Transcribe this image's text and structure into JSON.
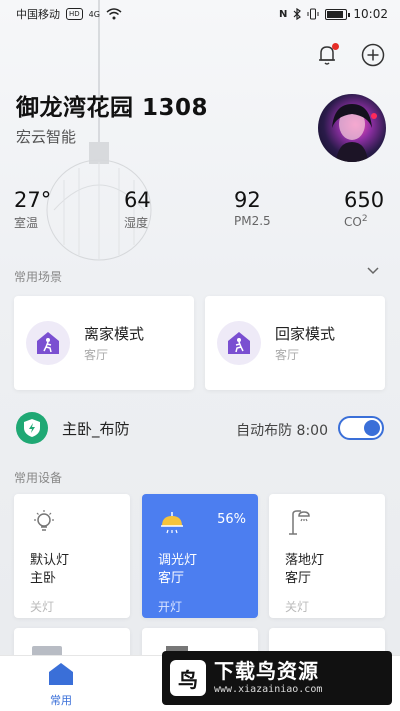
{
  "status_bar": {
    "carrier": "中国移动",
    "hd_badge": "HD",
    "network": "4G",
    "time": "10:02"
  },
  "home": {
    "title": "御龙湾花园 1308",
    "subtitle": "宏云智能"
  },
  "stats": [
    {
      "value": "27°",
      "label": "室温"
    },
    {
      "value": "64",
      "label": "湿度"
    },
    {
      "value": "92",
      "label": "PM2.5"
    },
    {
      "value": "650",
      "label": "CO",
      "label_sup": "2"
    }
  ],
  "scenes_section": {
    "label": "常用场景"
  },
  "scenes": [
    {
      "name": "离家模式",
      "room": "客厅"
    },
    {
      "name": "回家模式",
      "room": "客厅"
    }
  ],
  "security": {
    "name": "主卧_布防",
    "auto_text": "自动布防 8:00",
    "enabled": true
  },
  "devices_section": {
    "label": "常用设备"
  },
  "devices": [
    {
      "name": "默认灯",
      "room": "主卧",
      "state": "关灯",
      "icon": "bulb-icon"
    },
    {
      "name": "调光灯",
      "room": "客厅",
      "state": "开灯",
      "icon": "dimmer-lamp-icon",
      "level": "56%"
    },
    {
      "name": "落地灯",
      "room": "客厅",
      "state": "关灯",
      "icon": "floor-lamp-icon"
    }
  ],
  "bottom_nav": {
    "home_label": "常用"
  },
  "watermark": {
    "title": "下载鸟资源",
    "url": "www.xiazainiao.com"
  },
  "colors": {
    "accent": "#3a6fd8",
    "active_card": "#4c7ef0",
    "scene_icon": "#7a4fd1",
    "shield": "#1fa874",
    "notify_dot": "#e52d27"
  }
}
